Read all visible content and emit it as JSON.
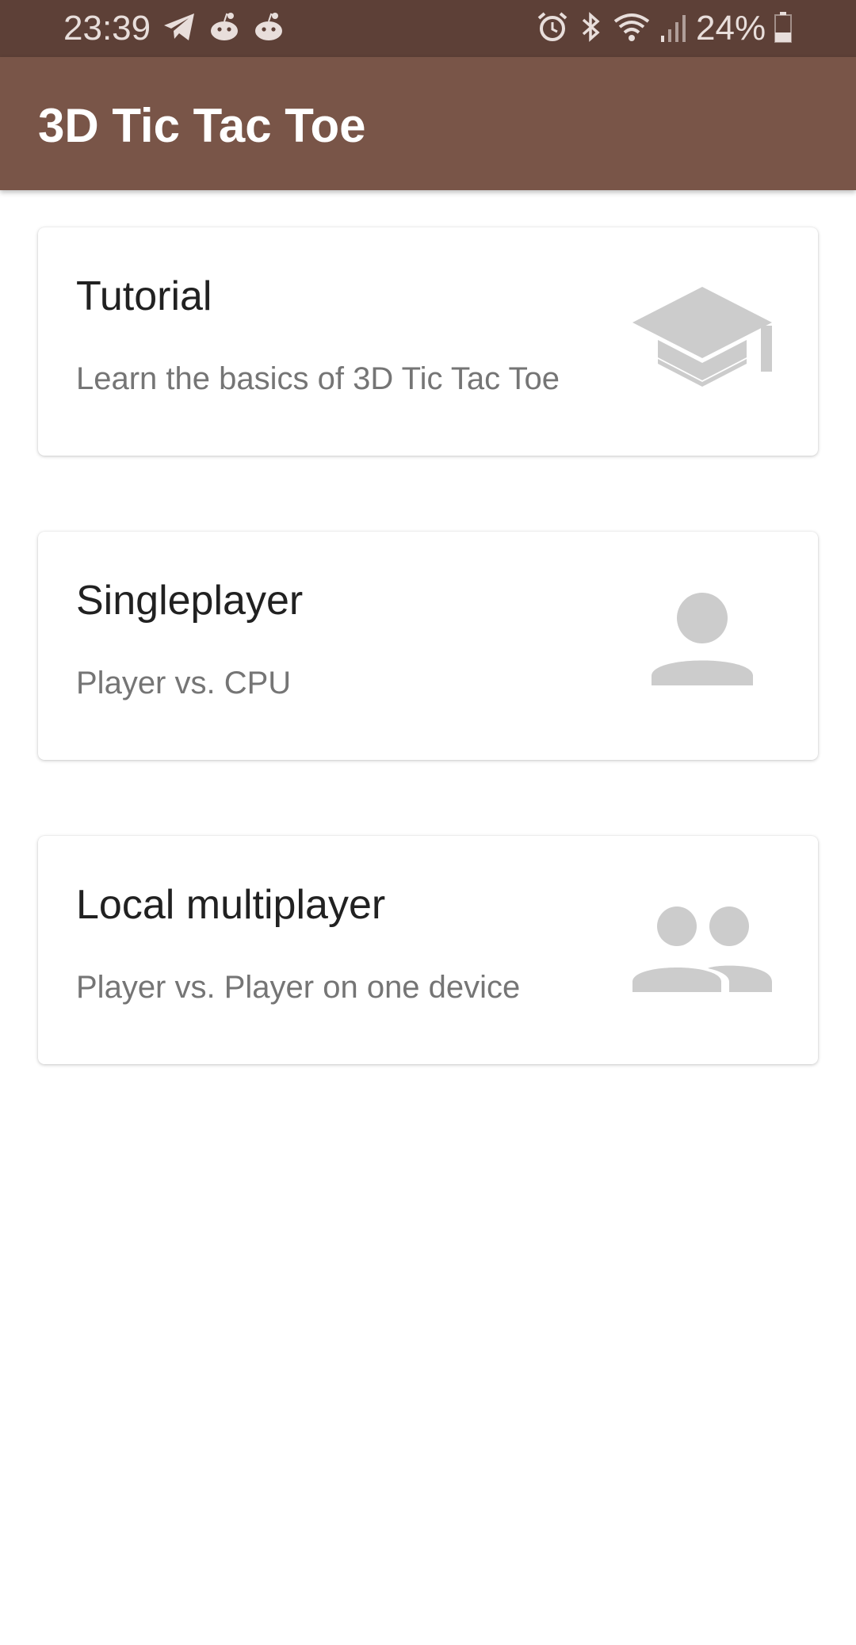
{
  "status_bar": {
    "time": "23:39",
    "battery": "24%",
    "left_icons": [
      "telegram-icon",
      "reddit-icon",
      "reddit-icon"
    ],
    "right_icons": [
      "alarm-icon",
      "bluetooth-icon",
      "wifi-icon",
      "signal-icon",
      "battery-icon"
    ]
  },
  "app_bar": {
    "title": "3D Tic Tac Toe"
  },
  "cards": [
    {
      "title": "Tutorial",
      "subtitle": "Learn the basics of 3D Tic Tac Toe",
      "icon": "graduation-cap-icon"
    },
    {
      "title": "Singleplayer",
      "subtitle": "Player vs. CPU",
      "icon": "person-icon"
    },
    {
      "title": "Local multiplayer",
      "subtitle": "Player vs. Player on one device",
      "icon": "people-icon"
    }
  ],
  "colors": {
    "status_bar": "#5d4037",
    "app_bar": "#795548",
    "icon_gray": "#cccccc"
  }
}
